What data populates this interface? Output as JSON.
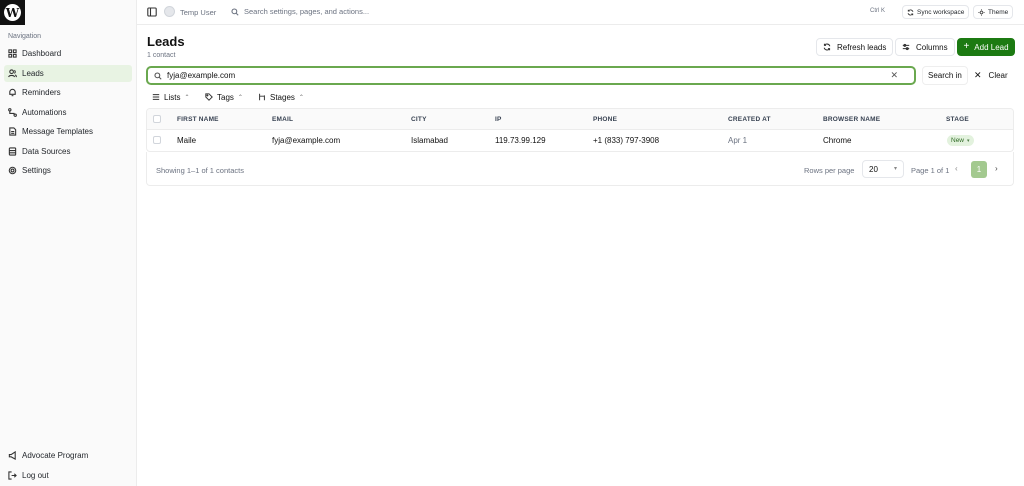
{
  "sidebar": {
    "heading": "Navigation",
    "items": [
      {
        "label": "Dashboard",
        "icon": "grid-icon",
        "active": false
      },
      {
        "label": "Leads",
        "icon": "users-icon",
        "active": true
      },
      {
        "label": "Reminders",
        "icon": "bell-icon",
        "active": false
      },
      {
        "label": "Automations",
        "icon": "workflow-icon",
        "active": false
      },
      {
        "label": "Message Templates",
        "icon": "file-icon",
        "active": false
      },
      {
        "label": "Data Sources",
        "icon": "database-icon",
        "active": false
      },
      {
        "label": "Settings",
        "icon": "gear-icon",
        "active": false
      }
    ],
    "bottom_items": [
      {
        "label": "Advocate Program",
        "icon": "megaphone-icon"
      },
      {
        "label": "Log out",
        "icon": "logout-icon"
      }
    ]
  },
  "topbar": {
    "user_name": "Temp User",
    "search_placeholder": "Search settings, pages, and actions...",
    "shortcut": "Ctrl K",
    "sync_label": "Sync workspace",
    "theme_label": "Theme"
  },
  "header": {
    "title": "Leads",
    "subtitle": "1 contact",
    "refresh_label": "Refresh leads",
    "columns_label": "Columns",
    "add_label": "Add Lead"
  },
  "search": {
    "value": "fyja@example.com",
    "search_in_label": "Search in",
    "clear_label": "Clear"
  },
  "filters": {
    "lists": "Lists",
    "tags": "Tags",
    "stages": "Stages"
  },
  "table": {
    "columns": [
      "FIRST NAME",
      "EMAIL",
      "CITY",
      "IP",
      "PHONE",
      "CREATED AT",
      "BROWSER NAME",
      "STAGE"
    ],
    "rows": [
      {
        "first_name": "Maile",
        "email": "fyja@example.com",
        "city": "Islamabad",
        "ip": "119.73.99.129",
        "phone": "+1 (833) 797-3908",
        "created_at": "Apr 1",
        "browser": "Chrome",
        "stage": "New"
      }
    ]
  },
  "pagination": {
    "showing": "Showing 1–1 of 1 contacts",
    "rows_per_page_label": "Rows per page",
    "rows_per_page": "20",
    "page_label": "Page 1 of 1",
    "current_page": "1"
  },
  "colors": {
    "accent": "#1c7a12",
    "active_nav": "#e8f3e3",
    "search_border": "#6aa84f",
    "page_active": "#a3c98f"
  }
}
